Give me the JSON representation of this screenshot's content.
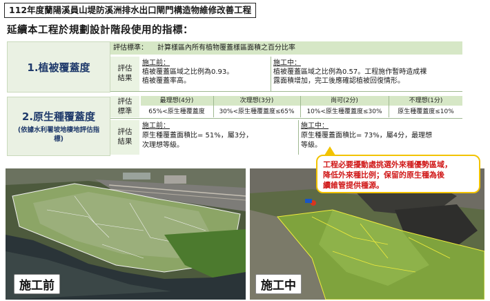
{
  "header": {
    "title": "112年度蘭陽溪員山堤防溪洲排水出口閘門構造物維修改善工程",
    "subtitle": "延續本工程於規劃設計階段使用的指標："
  },
  "indicator1": {
    "label": "1.植被覆蓋度",
    "criteria_label": "評估標準：",
    "criteria_text": "計算樣區內所有植物覆蓋樣區面積之百分比率",
    "result_label": "評估結果",
    "before_title": "施工前：",
    "before_lines": [
      "植被覆蓋區域之比例為0.93。",
      "植被覆蓋率高。"
    ],
    "during_title": "施工中：",
    "during_lines": [
      "植被覆蓋區域之比例為0.57。工程施作暫時造成裸",
      "露面積增加，完工後應確認植被回復情形。"
    ]
  },
  "indicator2": {
    "label": "2.原生種覆蓋度",
    "note": "(依據水利署坡地棲地評估指標)",
    "criteria_label": "評估標準",
    "result_label": "評估結果",
    "scale_headers": [
      "最理想(4分)",
      "次理想(3分)",
      "尚可(2分)",
      "不理想(1分)"
    ],
    "scale_values": [
      "65%<原生種覆蓋度",
      "30%<原生種覆蓋度≤65%",
      "10%<原生種覆蓋度≤30%",
      "原生種覆蓋度≤10%"
    ],
    "before_title": "施工前：",
    "before_lines": [
      "原生種覆蓋面積比= 51%，屬3分，",
      "次理想等級。"
    ],
    "during_title": "施工中：",
    "during_lines": [
      "原生種覆蓋面積比= 73%，屬4分，最理想",
      "等級。"
    ]
  },
  "callout": {
    "lines": [
      "工程必要擾動處挑選外來種優勢區域，",
      "降低外來種比例；保留的原生種為後",
      "續維管提供種源。"
    ]
  },
  "photos": {
    "before_label": "施工前",
    "during_label": "施工中"
  },
  "colors": {
    "label_blue": "#1f3a6b",
    "callout_red": "#d01818",
    "callout_border": "#f2c300",
    "header_green": "#d6e7c6"
  }
}
